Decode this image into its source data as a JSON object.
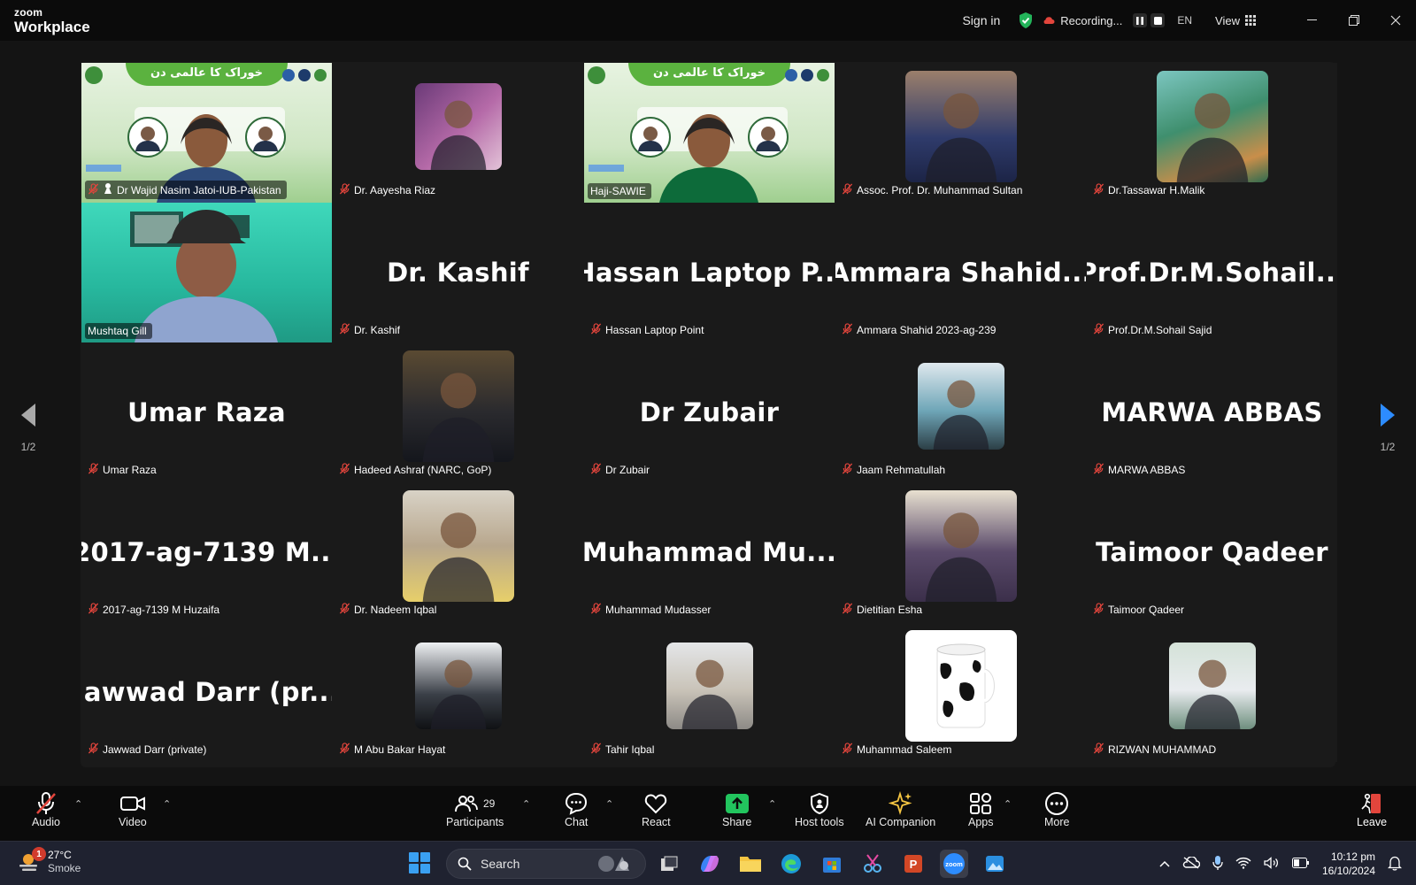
{
  "app": {
    "brand_small": "zoom",
    "brand_big": "Workplace"
  },
  "titlebar": {
    "sign_in": "Sign in",
    "recording": "Recording...",
    "language": "EN",
    "view": "View"
  },
  "navigation": {
    "page_left": "1/2",
    "page_right": "1/2"
  },
  "tiles": [
    {
      "row": 0,
      "col": 0,
      "label": "Dr Wajid Nasim Jatoi-IUB-Pakistan",
      "display": "",
      "type": "video-banner",
      "active": true,
      "muted": true
    },
    {
      "row": 0,
      "col": 1,
      "label": "Dr. Aayesha Riaz",
      "display": "",
      "type": "avatar",
      "muted": true
    },
    {
      "row": 0,
      "col": 2,
      "label": "Haji-SAWIE",
      "display": "",
      "type": "video-banner",
      "muted": false
    },
    {
      "row": 0,
      "col": 3,
      "label": "Assoc. Prof. Dr. Muhammad Sultan",
      "display": "",
      "type": "avatar",
      "muted": true
    },
    {
      "row": 0,
      "col": 4,
      "label": "Dr.Tassawar H.Malik",
      "display": "",
      "type": "avatar",
      "muted": true
    },
    {
      "row": 1,
      "col": 0,
      "label": "Mushtaq Gill",
      "display": "",
      "type": "video",
      "muted": false
    },
    {
      "row": 1,
      "col": 1,
      "label": "Dr. Kashif",
      "display": "Dr. Kashif",
      "type": "name",
      "muted": true
    },
    {
      "row": 1,
      "col": 2,
      "label": "Hassan Laptop Point",
      "display": "Hassan Laptop P...",
      "type": "name",
      "muted": true
    },
    {
      "row": 1,
      "col": 3,
      "label": "Ammara Shahid 2023-ag-239",
      "display": "Ammara Shahid...",
      "type": "name",
      "muted": true
    },
    {
      "row": 1,
      "col": 4,
      "label": "Prof.Dr.M.Sohail Sajid",
      "display": "Prof.Dr.M.Sohail...",
      "type": "name",
      "muted": true
    },
    {
      "row": 2,
      "col": 0,
      "label": "Umar Raza",
      "display": "Umar Raza",
      "type": "name",
      "muted": true
    },
    {
      "row": 2,
      "col": 1,
      "label": "Hadeed Ashraf (NARC, GoP)",
      "display": "",
      "type": "avatar",
      "muted": true
    },
    {
      "row": 2,
      "col": 2,
      "label": "Dr Zubair",
      "display": "Dr Zubair",
      "type": "name",
      "muted": true
    },
    {
      "row": 2,
      "col": 3,
      "label": "Jaam Rehmatullah",
      "display": "",
      "type": "avatar",
      "muted": true
    },
    {
      "row": 2,
      "col": 4,
      "label": "MARWA ABBAS",
      "display": "MARWA ABBAS",
      "type": "name",
      "muted": true
    },
    {
      "row": 3,
      "col": 0,
      "label": "2017-ag-7139 M Huzaifa",
      "display": "2017-ag-7139 M...",
      "type": "name",
      "muted": true
    },
    {
      "row": 3,
      "col": 1,
      "label": "Dr. Nadeem Iqbal",
      "display": "",
      "type": "avatar",
      "muted": true
    },
    {
      "row": 3,
      "col": 2,
      "label": "Muhammad Mudasser",
      "display": "Muhammad Mu...",
      "type": "name",
      "muted": true
    },
    {
      "row": 3,
      "col": 3,
      "label": "Dietitian Esha",
      "display": "",
      "type": "avatar",
      "muted": true
    },
    {
      "row": 3,
      "col": 4,
      "label": "Taimoor Qadeer",
      "display": "Taimoor Qadeer",
      "type": "name",
      "muted": true
    },
    {
      "row": 4,
      "col": 0,
      "label": "Jawwad Darr (private)",
      "display": "Jawwad Darr (pr...",
      "type": "name",
      "muted": true
    },
    {
      "row": 4,
      "col": 1,
      "label": "M Abu Bakar Hayat",
      "display": "",
      "type": "avatar",
      "muted": true
    },
    {
      "row": 4,
      "col": 2,
      "label": "Tahir Iqbal",
      "display": "",
      "type": "avatar",
      "muted": true
    },
    {
      "row": 4,
      "col": 3,
      "label": "Muhammad Saleem",
      "display": "",
      "type": "avatar",
      "muted": true
    },
    {
      "row": 4,
      "col": 4,
      "label": "RIZWAN MUHAMMAD",
      "display": "",
      "type": "avatar",
      "muted": true
    }
  ],
  "banner": {
    "title": "خوراک کا عالمی دن"
  },
  "toolbar": {
    "audio": "Audio",
    "video": "Video",
    "participants": "Participants",
    "participants_count": "29",
    "chat": "Chat",
    "react": "React",
    "share": "Share",
    "host_tools": "Host tools",
    "ai_companion": "AI Companion",
    "apps": "Apps",
    "more": "More",
    "leave": "Leave"
  },
  "taskbar": {
    "weather_temp": "27°C",
    "weather_desc": "Smoke",
    "weather_badge": "1",
    "search_placeholder": "Search",
    "time": "10:12 pm",
    "date": "16/10/2024"
  },
  "colors": {
    "active_border": "#2fd06b",
    "share_green": "#22c55e",
    "mic_muted_red": "#e2453c",
    "accent_blue": "#2d8cff"
  }
}
